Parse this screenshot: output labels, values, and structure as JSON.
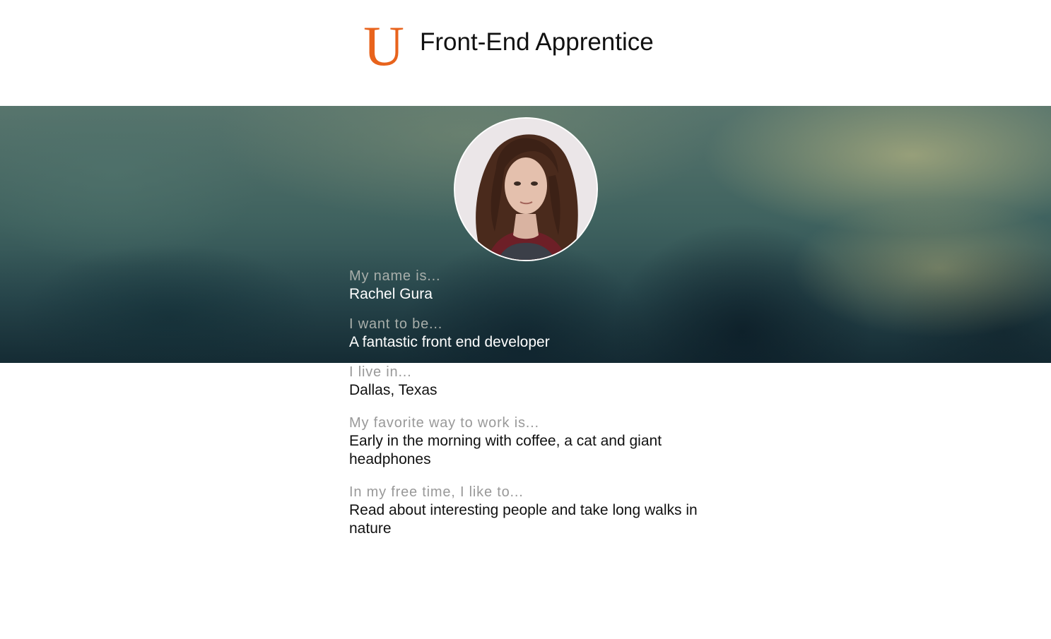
{
  "header": {
    "logo_letter": "U",
    "title": "Front-End Apprentice"
  },
  "colors": {
    "brand_orange": "#e8631c",
    "label_gray": "#999999",
    "value_dark": "#111111",
    "value_light": "#ffffff"
  },
  "profile": {
    "fields": [
      {
        "label": "My name is...",
        "value": "Rachel Gura"
      },
      {
        "label": "I want to be...",
        "value": "A fantastic front end developer"
      },
      {
        "label": "I live in...",
        "value": "Dallas, Texas"
      },
      {
        "label": "My favorite way to work is...",
        "value": "Early in the morning with coffee, a cat and giant headphones"
      },
      {
        "label": "In my free time, I like to...",
        "value": "Read about interesting people and take long walks in nature"
      }
    ]
  }
}
